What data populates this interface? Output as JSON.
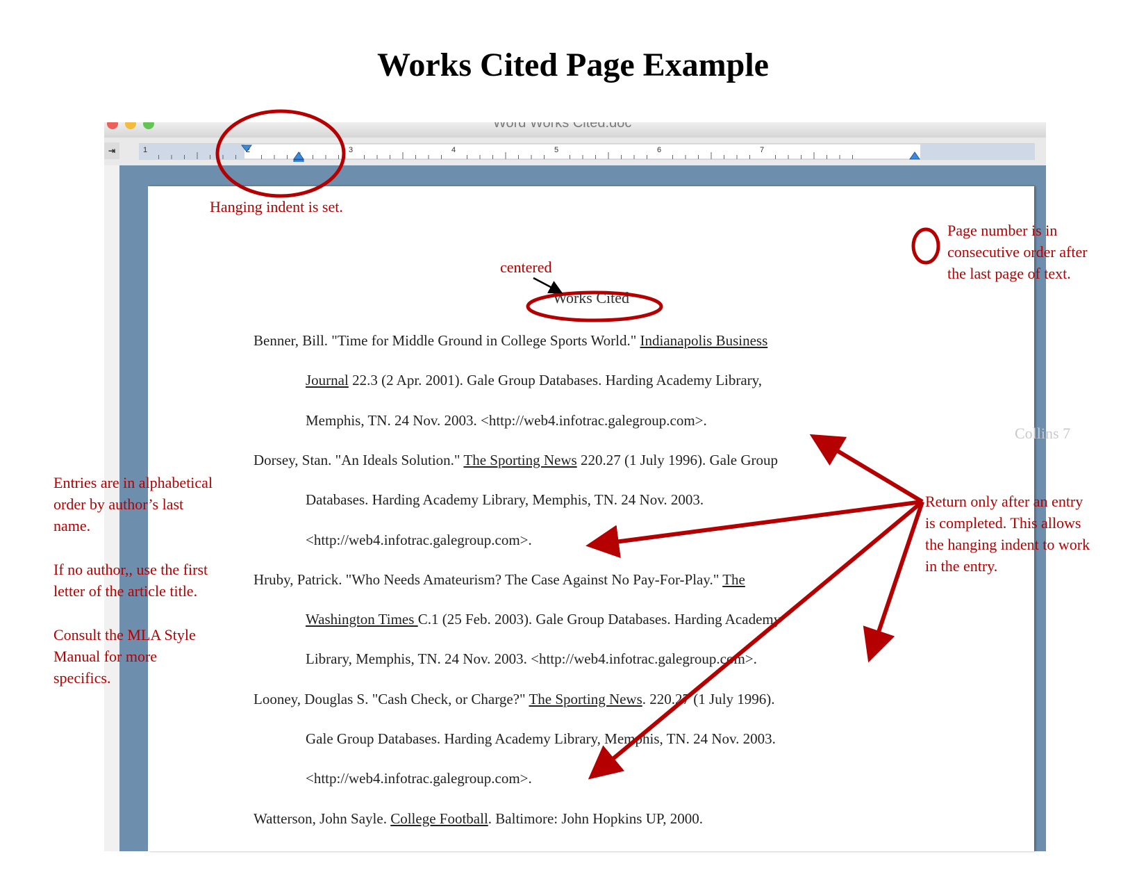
{
  "page_title": "Works Cited Page Example",
  "window": {
    "title": "Word Works Cited.doc",
    "tab_selector_icon": "tab-stop-selector-icon",
    "traffic_lights": [
      "#ec5f5a",
      "#f2bd3d",
      "#62c554"
    ],
    "ruler_numbers": [
      "1",
      "2",
      "3",
      "4",
      "5",
      "6",
      "7"
    ]
  },
  "document": {
    "running_head": "Collins 7",
    "heading": "Works Cited",
    "entries": [
      {
        "lines": [
          [
            "Benner, Bill.  \"Time for Middle Ground in College Sports World.\"  ",
            "u:Indianapolis Business"
          ],
          [
            "u:Journal",
            " 22.3  (2 Apr. 2001).  Gale Group Databases.  Harding Academy Library,"
          ],
          [
            "Memphis, TN.  24  Nov. 2003.  <http://web4.infotrac.galegroup.com>."
          ]
        ]
      },
      {
        "lines": [
          [
            "Dorsey, Stan.  \"An Ideals Solution.\"  ",
            "u:The Sporting News",
            " 220.27 (1 July 1996).  Gale Group"
          ],
          [
            "Databases.  Harding Academy Library, Memphis, TN.  24  Nov. 2003."
          ],
          [
            "<http://web4.infotrac.galegroup.com>."
          ]
        ]
      },
      {
        "lines": [
          [
            "Hruby, Patrick.  \"Who Needs Amateurism?  The Case Against No Pay-For-Play.\"  ",
            "u:The"
          ],
          [
            "u:Washington Times ",
            "  C.1 (25 Feb. 2003).  Gale Group Databases.  Harding Academy"
          ],
          [
            "Library,  Memphis, TN.  24  Nov. 2003.  <http://web4.infotrac.galegroup.com>."
          ]
        ]
      },
      {
        "lines": [
          [
            "Looney, Douglas S.  \"Cash Check, or Charge?\"  ",
            "u:The Sporting News",
            ".  220.27 (1 July 1996)."
          ],
          [
            "Gale Group Databases.  Harding Academy Library, Memphis, TN.  24  Nov. 2003."
          ],
          [
            "<http://web4.infotrac.galegroup.com>."
          ]
        ]
      },
      {
        "lines": [
          [
            "Watterson, John Sayle.  ",
            "u:College Football",
            ".  Baltimore:  John Hopkins UP, 2000."
          ]
        ]
      }
    ]
  },
  "annotations": {
    "hanging_indent": "Hanging indent is set.",
    "page_number": [
      "Page number is in",
      "consecutive order after",
      "the last page of text."
    ],
    "centered": "centered",
    "alphabetical": [
      "Entries are in alphabetical",
      "order by author’s last",
      "name."
    ],
    "no_author": [
      "If no author,, use the first",
      "letter of the article title."
    ],
    "consult": [
      "Consult the MLA Style",
      "Manual for more",
      "specifics."
    ],
    "return_entry": [
      "Return only after an entry",
      "is completed.  This allows",
      "the hanging indent to work",
      "in the entry."
    ],
    "annotation_color": "#b40000"
  }
}
